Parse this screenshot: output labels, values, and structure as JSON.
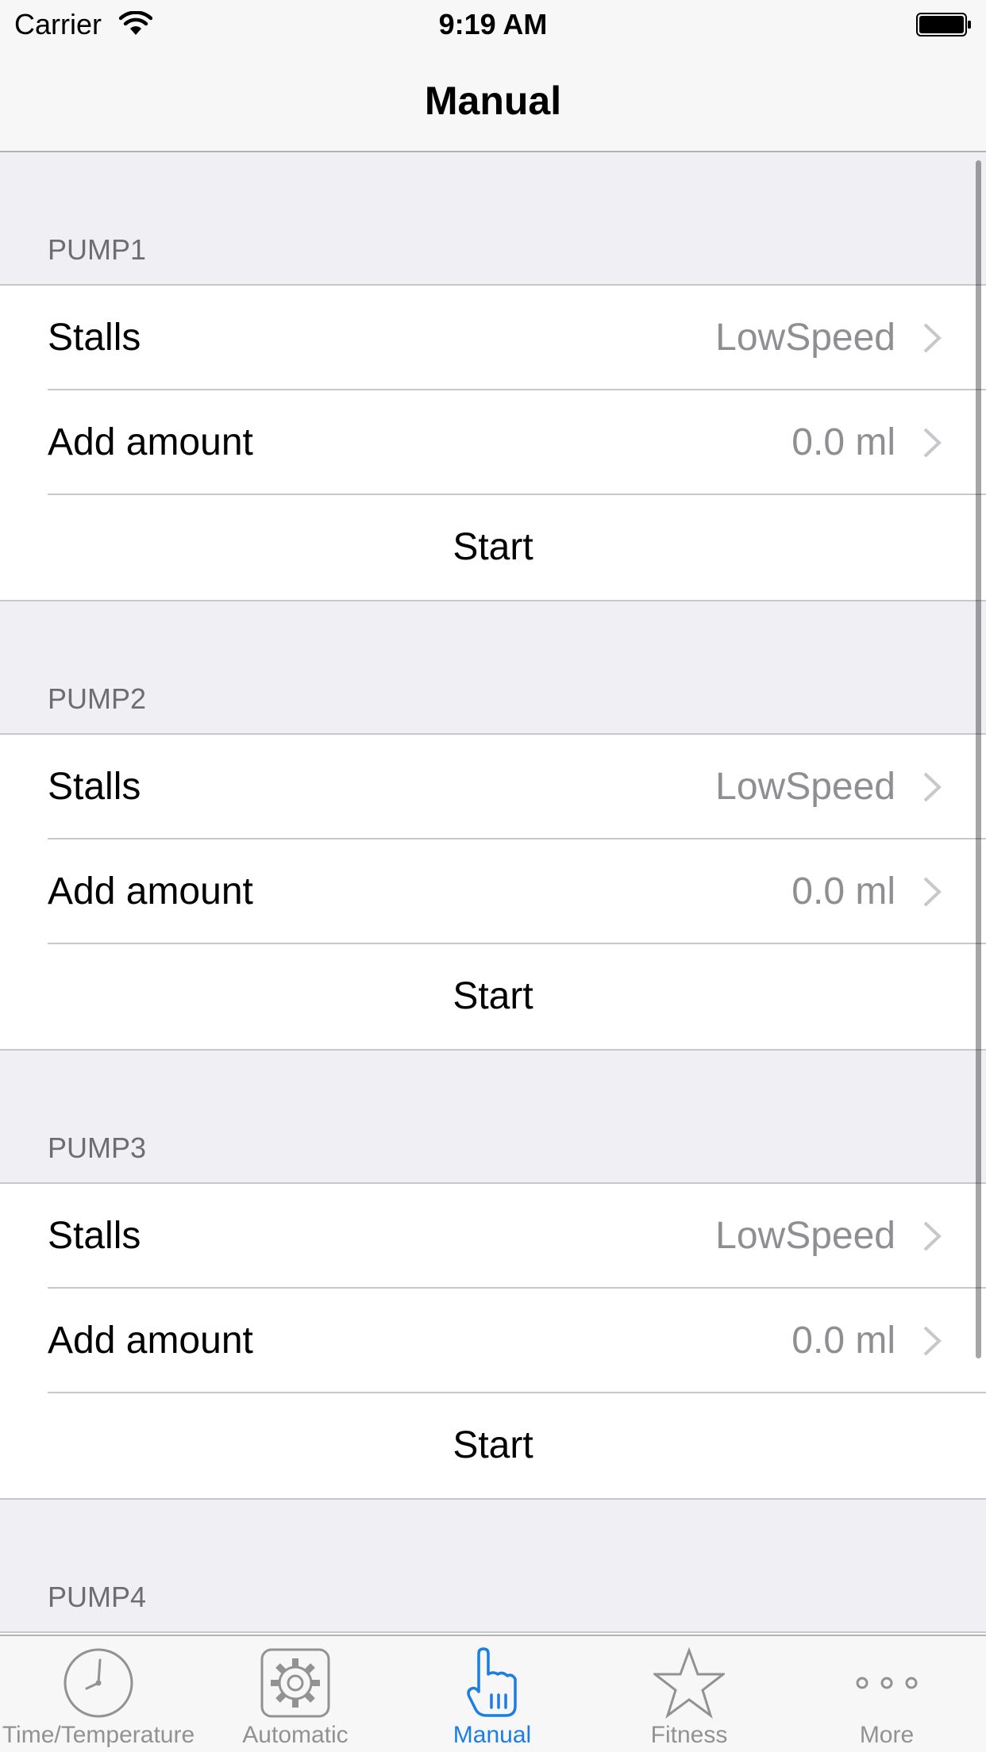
{
  "status_bar": {
    "carrier": "Carrier",
    "time": "9:19 AM"
  },
  "nav": {
    "title": "Manual"
  },
  "sections": [
    {
      "header": "PUMP1",
      "stalls_label": "Stalls",
      "stalls_value": "LowSpeed",
      "amount_label": "Add amount",
      "amount_value": "0.0 ml",
      "start_label": "Start"
    },
    {
      "header": "PUMP2",
      "stalls_label": "Stalls",
      "stalls_value": "LowSpeed",
      "amount_label": "Add amount",
      "amount_value": "0.0 ml",
      "start_label": "Start"
    },
    {
      "header": "PUMP3",
      "stalls_label": "Stalls",
      "stalls_value": "LowSpeed",
      "amount_label": "Add amount",
      "amount_value": "0.0 ml",
      "start_label": "Start"
    },
    {
      "header": "PUMP4"
    }
  ],
  "tabs": [
    {
      "label": "Time/Temperature",
      "icon": "clock-icon"
    },
    {
      "label": "Automatic",
      "icon": "gear-icon"
    },
    {
      "label": "Manual",
      "icon": "hand-pointer-icon",
      "active": true
    },
    {
      "label": "Fitness",
      "icon": "star-icon"
    },
    {
      "label": "More",
      "icon": "more-dots-icon"
    }
  ],
  "colors": {
    "accent": "#1a7ee6",
    "background": "#efeff4",
    "secondary_text": "#8e8e93"
  }
}
